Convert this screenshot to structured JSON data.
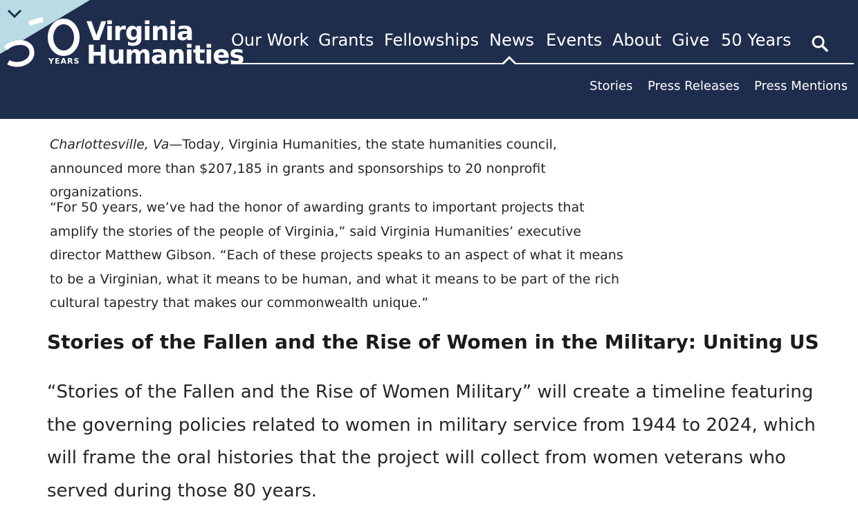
{
  "header": {
    "logo": {
      "line1": "Virginia",
      "line2": "Humanities",
      "anniversary": "50",
      "years_label": "YEARS"
    },
    "nav_items": [
      "Our Work",
      "Grants",
      "Fellowships",
      "News",
      "Events",
      "About",
      "Give",
      "50 Years"
    ],
    "active_nav": "News",
    "sub_nav_items": [
      "Stories",
      "Press Releases",
      "Press Mentions"
    ],
    "colors": {
      "background": "#1f2d4d",
      "corner": "#b9dbe4",
      "text": "#ffffff"
    },
    "icons": {
      "toggle": "chevron-down-icon",
      "search": "search-icon"
    }
  },
  "article": {
    "dateline": "Charlottesville, Va",
    "intro_text": "—Today, Virginia Humanities, the state humanities council, announced more than $207,185 in grants and sponsorships to 20 nonprofit organizations.",
    "quote": "“For 50 years, we’ve had the honor of awarding grants to important projects that amplify the stories of the people of Virginia,” said Virginia Humanities’ executive director Matthew Gibson. “Each of these projects speaks to an aspect of what it means to be a Virginian, what it means to be human, and what it means to be part of the rich cultural tapestry that makes our commonwealth unique.”",
    "section_title": "Stories of the Fallen and the Rise of Women in the Military: Uniting US",
    "section_body": "“Stories of the Fallen and the Rise of Women Military” will create a timeline featuring the governing policies related to women in military service from 1944 to 2024, which will frame the oral histories that the project will collect from women veterans who served during those 80 years."
  }
}
